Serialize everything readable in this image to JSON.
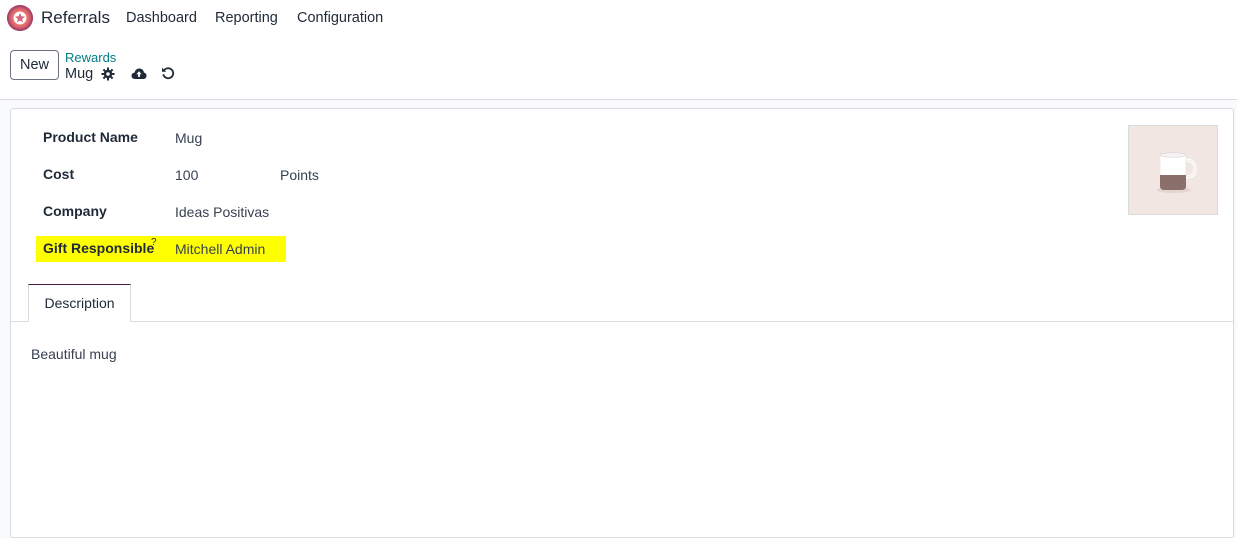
{
  "navbar": {
    "app_name": "Referrals",
    "menu": [
      "Dashboard",
      "Reporting",
      "Configuration"
    ]
  },
  "control_panel": {
    "new_label": "New",
    "breadcrumb_parent": "Rewards",
    "breadcrumb_current": "Mug",
    "icons": [
      "gear-icon",
      "cloud-upload-icon",
      "undo-icon"
    ]
  },
  "form": {
    "fields": [
      {
        "label": "Product Name",
        "value": "Mug"
      },
      {
        "label": "Cost",
        "value": "100",
        "suffix": "Points"
      },
      {
        "label": "Company",
        "value": "Ideas Positivas"
      },
      {
        "label": "Gift Responsible",
        "help": "?",
        "value": "Mitchell Admin"
      }
    ],
    "highlight_color": "#ffff00"
  },
  "tabs": {
    "active": "Description"
  },
  "description": {
    "text": "Beautiful mug"
  },
  "colors": {
    "breadcrumb_link": "#017e84",
    "tab_accent": "#4b1b3f"
  }
}
